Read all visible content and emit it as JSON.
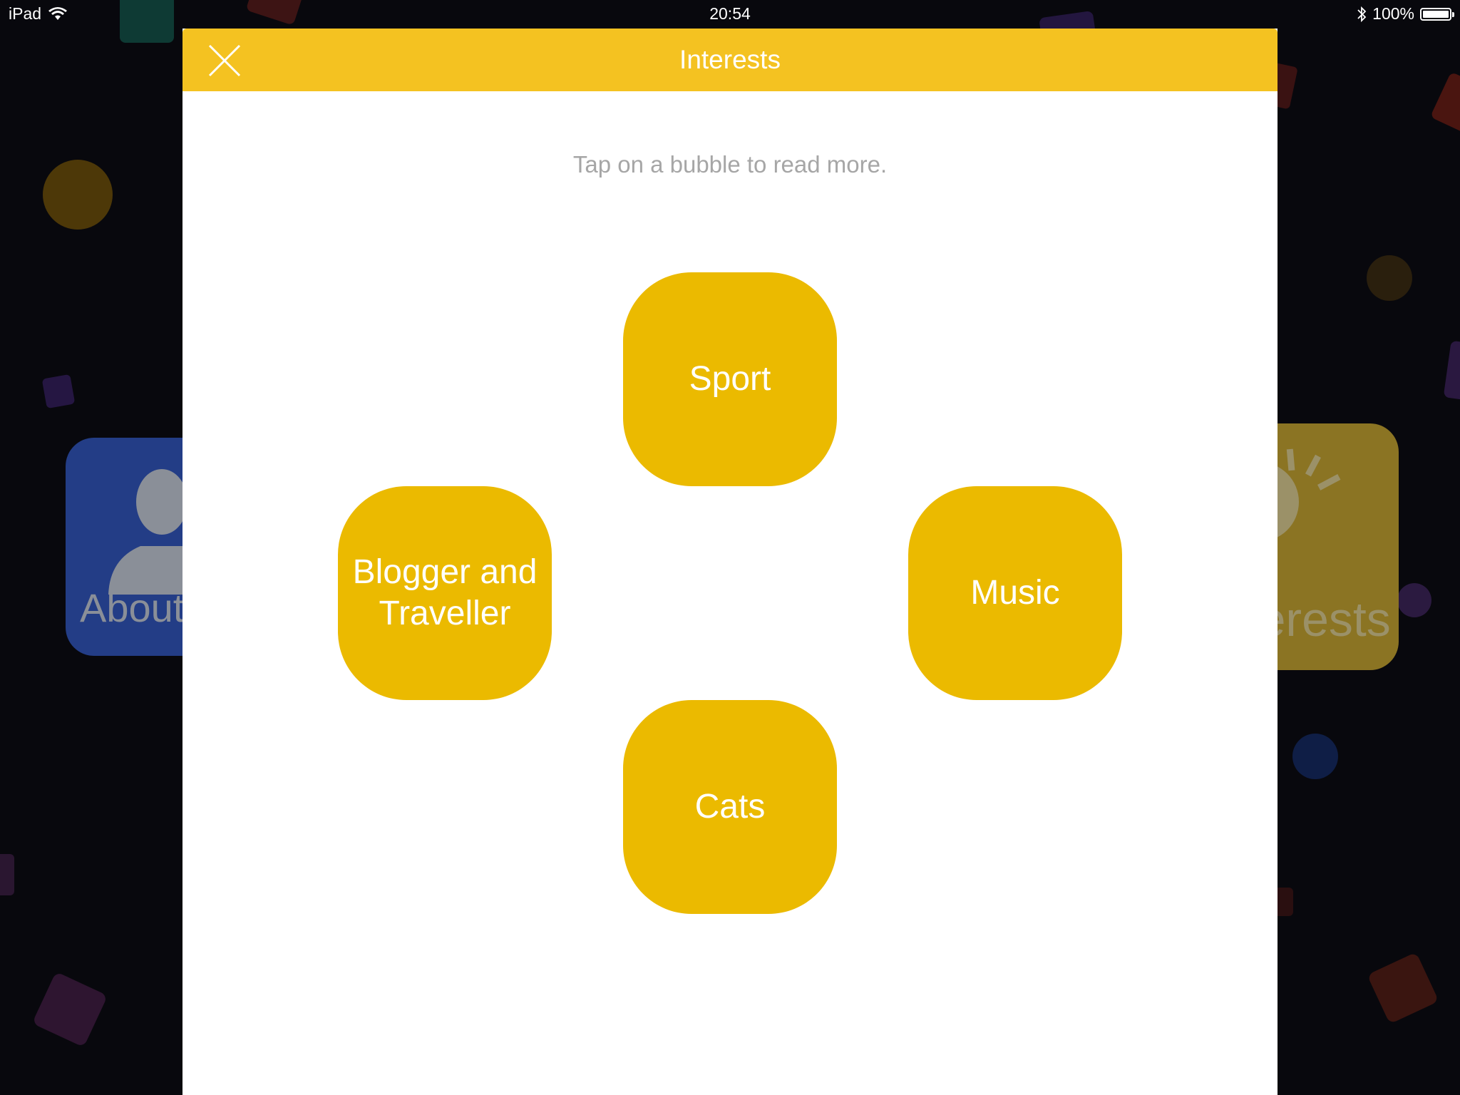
{
  "status_bar": {
    "device": "iPad",
    "time": "20:54",
    "battery": "100%",
    "icons": [
      "wifi-icon",
      "bluetooth-icon",
      "battery-icon"
    ]
  },
  "background": {
    "about_tile_label": "About",
    "interests_tile_label": "Interests",
    "about_icon": "person-silhouette-icon",
    "interests_icon": "lightbulb-icon"
  },
  "modal": {
    "title": "Interests",
    "close_icon": "close-icon",
    "hint": "Tap on a bubble to read more.",
    "bubbles": [
      {
        "label": "Sport"
      },
      {
        "label_line1": "Blogger and",
        "label_line2": "Traveller"
      },
      {
        "label": "Music"
      },
      {
        "label": "Cats"
      }
    ]
  },
  "colors": {
    "header": "#f4c221",
    "bubble": "#ebba00",
    "hint_text": "#a6a6a6",
    "background": "#08080d"
  }
}
